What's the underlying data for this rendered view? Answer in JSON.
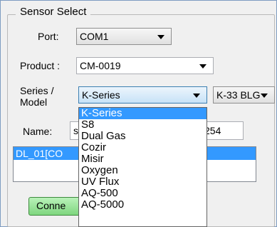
{
  "group_title": "Sensor Select",
  "port": {
    "label": "Port:",
    "value": "COM1"
  },
  "product": {
    "label": "Product :",
    "value": "CM-0019"
  },
  "series": {
    "label_line1": "Series /",
    "label_line2": "Model",
    "value": "K-Series"
  },
  "model": {
    "value": "K-33 BLG"
  },
  "name": {
    "label": "Name:",
    "value_left": "s",
    "value_right": "254"
  },
  "device_list": {
    "items": [
      "DL_01[CO"
    ]
  },
  "connect_button": {
    "label": "Conne"
  },
  "series_dropdown": {
    "options": [
      "K-Series",
      "S8",
      "Dual Gas",
      "Cozir",
      "Misir",
      "Oxygen",
      "UV Flux",
      "AQ-500",
      "AQ-5000"
    ],
    "highlighted": "K-Series"
  }
}
